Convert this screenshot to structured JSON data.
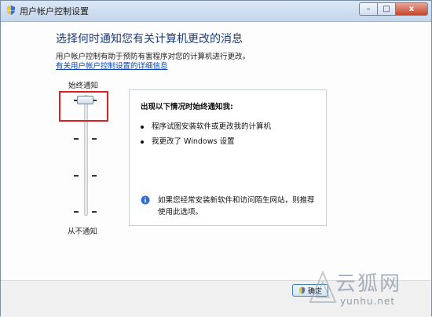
{
  "window": {
    "title": "用户帐户控制设置",
    "buttons": {
      "minimize": "–",
      "maximize": "□",
      "close": "x"
    }
  },
  "main": {
    "heading": "选择何时通知您有关计算机更改的消息",
    "description": "用户帐户控制有助于预防有害程序对您的计算机进行更改。",
    "more_link": "有关用户帐户控制设置的详细信息"
  },
  "slider": {
    "top_label": "始终通知",
    "bottom_label": "从不通知",
    "levels": 4,
    "selected_level": 4
  },
  "info_panel": {
    "title": "出现以下情况时始终通知我:",
    "bullets": [
      "程序试图安装软件或更改我的计算机",
      "我更改了 Windows 设置"
    ],
    "tip": "如果您经常安装新软件和访问陌生网站，则推荐使用此选项。",
    "tip_icon": "info-icon"
  },
  "footer": {
    "ok_label": "确定"
  },
  "watermark": {
    "brand": "云狐网",
    "url": "yunhu.net"
  },
  "colors": {
    "heading": "#1e3c7b",
    "link": "#0645b6",
    "highlight": "#e02020",
    "close_button": "#c4452b"
  }
}
